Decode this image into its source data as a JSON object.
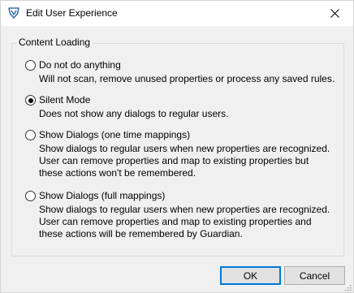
{
  "window": {
    "title": "Edit User Experience"
  },
  "group": {
    "label": "Content Loading"
  },
  "options": [
    {
      "label": "Do not do anything",
      "checked": false,
      "description": [
        "Will not scan, remove unused properties or process any saved rules."
      ]
    },
    {
      "label": "Silent Mode",
      "checked": true,
      "description": [
        "Does not show any dialogs to regular users."
      ]
    },
    {
      "label": "Show Dialogs (one time mappings)",
      "checked": false,
      "description": [
        "Show dialogs to regular users when new properties are recognized.",
        "User can remove properties and map to existing properties but",
        "these actions won't be remembered."
      ]
    },
    {
      "label": "Show Dialogs (full mappings)",
      "checked": false,
      "description": [
        "Show dialogs to regular users when new properties are recognized.",
        "User can remove properties and map to existing properties and",
        "these actions will be remembered by Guardian."
      ]
    }
  ],
  "buttons": {
    "ok": "OK",
    "cancel": "Cancel"
  },
  "icons": {
    "app": "shield-v-icon",
    "close": "close-icon",
    "grip": "resize-grip-icon"
  },
  "colors": {
    "accent": "#0078d7",
    "app_icon_blue": "#3a6fb0"
  }
}
